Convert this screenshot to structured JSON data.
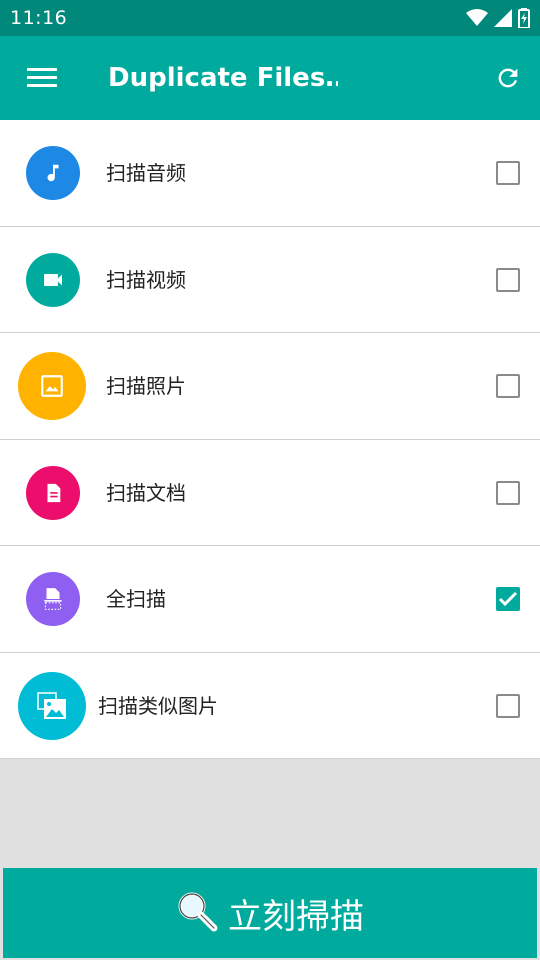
{
  "status_bar": {
    "time": "11:16",
    "icons": [
      "wifi-icon",
      "signal-icon",
      "battery-charging-icon"
    ]
  },
  "app_bar": {
    "title": "Duplicate Files…",
    "menu_icon": "hamburger-menu-icon",
    "refresh_icon": "refresh-icon",
    "color": "#00ab9e"
  },
  "scan_options": [
    {
      "label": "扫描音频",
      "icon": "music-note-icon",
      "color": "#1e88e5",
      "checked": false
    },
    {
      "label": "扫描视频",
      "icon": "video-camera-icon",
      "color": "#00ab9e",
      "checked": false
    },
    {
      "label": "扫描照片",
      "icon": "image-icon",
      "color": "#ffb300",
      "checked": false
    },
    {
      "label": "扫描文档",
      "icon": "document-icon",
      "color": "#ec0e6c",
      "checked": false
    },
    {
      "label": "全扫描",
      "icon": "scanner-icon",
      "color": "#8e5ff0",
      "checked": true
    },
    {
      "label": "扫描类似图片",
      "icon": "photo-library-icon",
      "color": "#00bcd4",
      "checked": false
    }
  ],
  "scan_button": {
    "label": "立刻掃描",
    "icon": "magnifier-icon"
  }
}
